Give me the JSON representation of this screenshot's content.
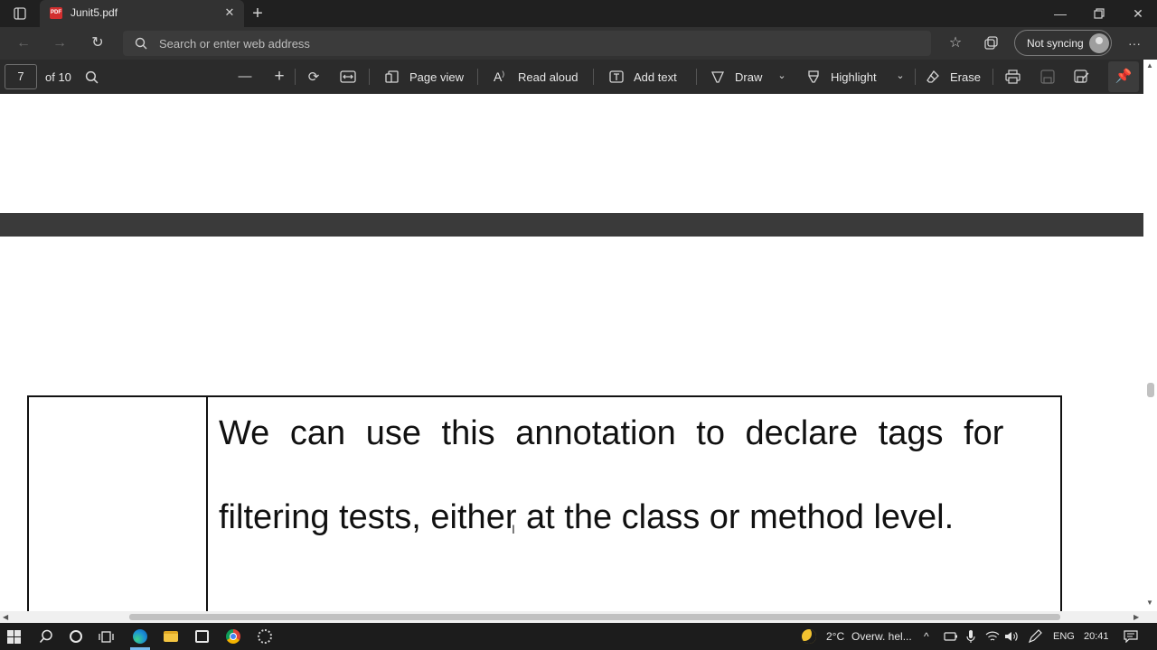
{
  "browser": {
    "tab_title": "Junit5.pdf",
    "pdf_icon_text": "PDF",
    "new_tab_symbol": "+",
    "address_placeholder": "Search or enter web address",
    "sync_label": "Not syncing",
    "more_symbol": "···"
  },
  "pdf_toolbar": {
    "page_number": "7",
    "page_total": "of 10",
    "zoom_out": "—",
    "zoom_in": "+",
    "page_view": "Page view",
    "read_aloud": "Read aloud",
    "add_text": "Add text",
    "draw": "Draw",
    "highlight": "Highlight",
    "erase": "Erase"
  },
  "document": {
    "line1": "We can use this annotation to declare tags for",
    "line2": "filtering tests, either at the class or method level."
  },
  "taskbar": {
    "weather_temp": "2°C",
    "weather_text": "Overw. hel...",
    "language": "ENG",
    "time": "20:41"
  },
  "icons": {
    "tab_actions": "tab-actions-icon",
    "back": "back-arrow-icon",
    "forward": "forward-arrow-icon",
    "refresh": "refresh-icon",
    "search": "search-icon",
    "favorites": "favorites-star-icon",
    "collections": "collections-icon",
    "profile": "profile-avatar-icon",
    "print": "print-icon",
    "save": "save-icon",
    "save_as": "save-as-icon",
    "pin": "pin-icon"
  },
  "colors": {
    "titlebar": "#202020",
    "toolbar": "#2b2b2b",
    "page_gap": "#3a3a3a",
    "document": "#ffffff",
    "taskbar": "#1c1c1c",
    "edge_accent": "#76b9ed"
  }
}
